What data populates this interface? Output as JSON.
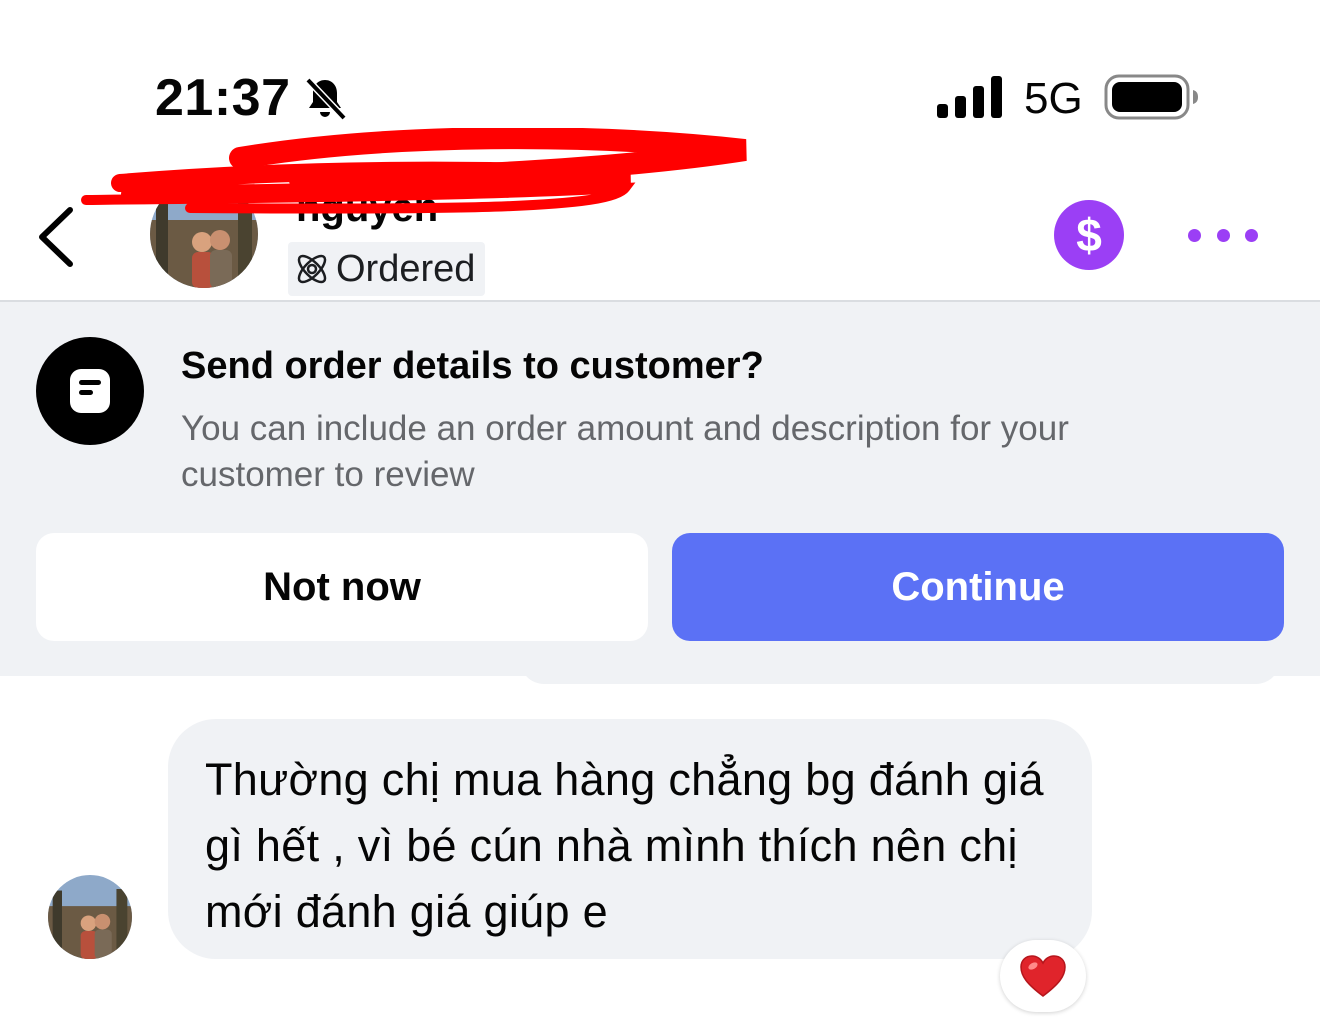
{
  "status_bar": {
    "time": "21:37",
    "network": "5G",
    "icons": [
      "bell-muted-icon",
      "signal-icon",
      "battery-icon"
    ]
  },
  "header": {
    "contact_name": "nguyen",
    "tag_label": "Ordered",
    "icons": [
      "back-icon",
      "dollar-icon",
      "more-icon",
      "ordered-icon"
    ],
    "accent_color": "#9b3ff5"
  },
  "order_prompt": {
    "title": "Send order details to customer?",
    "description": "You can include an order amount and description for your customer to review",
    "not_now_label": "Not now",
    "continue_label": "Continue",
    "continue_color": "#5b71f5"
  },
  "message": {
    "text": "Thường chị mua hàng chẳng bg đánh giá gì hết , vì bé cún nhà mình thích nên chị mới đánh giá giúp e",
    "reaction": "❤️"
  }
}
